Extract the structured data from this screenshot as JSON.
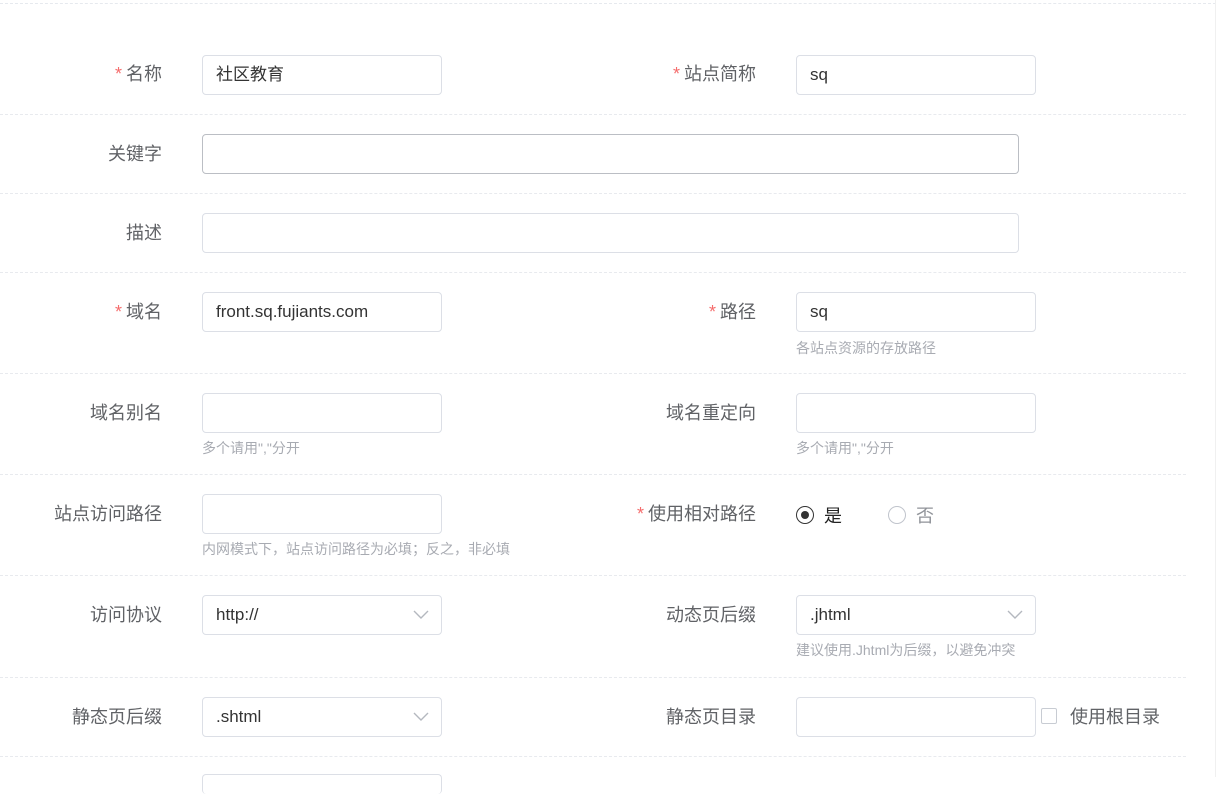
{
  "form": {
    "name": {
      "label": "名称",
      "required": "*",
      "value": "社区教育"
    },
    "short_name": {
      "label": "站点简称",
      "required": "*",
      "value": "sq"
    },
    "keywords": {
      "label": "关键字",
      "value": ""
    },
    "description": {
      "label": "描述",
      "value": ""
    },
    "domain": {
      "label": "域名",
      "required": "*",
      "value": "front.sq.fujiants.com"
    },
    "path": {
      "label": "路径",
      "required": "*",
      "value": "sq",
      "hint": "各站点资源的存放路径"
    },
    "domain_alias": {
      "label": "域名别名",
      "value": "",
      "hint": "多个请用\",\"分开"
    },
    "domain_redirect": {
      "label": "域名重定向",
      "value": "",
      "hint": "多个请用\",\"分开"
    },
    "access_path": {
      "label": "站点访问路径",
      "value": "",
      "hint": "内网模式下，站点访问路径为必填；反之，非必填"
    },
    "relative_path": {
      "label": "使用相对路径",
      "required": "*",
      "options": [
        {
          "label": "是",
          "checked": true
        },
        {
          "label": "否",
          "checked": false
        }
      ]
    },
    "protocol": {
      "label": "访问协议",
      "value": "http://"
    },
    "dynamic_suffix": {
      "label": "动态页后缀",
      "value": ".jhtml",
      "hint": "建议使用.Jhtml为后缀，以避免冲突"
    },
    "static_suffix": {
      "label": "静态页后缀",
      "value": ".shtml"
    },
    "static_dir": {
      "label": "静态页目录",
      "value": "",
      "checkbox_label": "使用根目录",
      "checkbox_checked": false
    }
  },
  "colors": {
    "required_star": "#f56c6c",
    "hint": "#a8abb2",
    "label": "#606266",
    "border": "#dcdfe6"
  },
  "icons": {
    "select_arrow": "chevron-down-icon"
  }
}
